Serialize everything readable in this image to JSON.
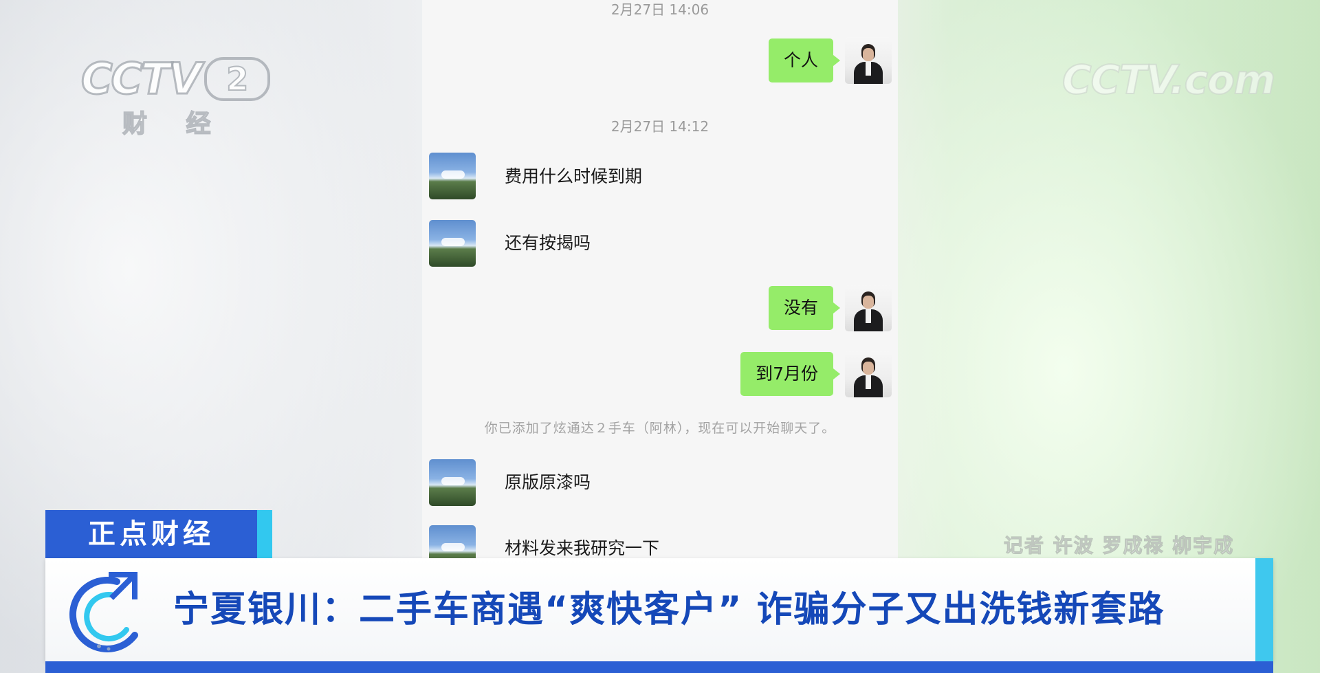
{
  "broadcast": {
    "channel_logo": "CCTV",
    "channel_number": "2",
    "channel_name": "财 经",
    "watermark": "CCTV.com",
    "program_tag": "正点财经",
    "headline": "宁夏银川：二手车商遇“爽快客户” 诈骗分子又出洗钱新套路",
    "credits": "记者 许波 罗成禄 柳宇成"
  },
  "chat": {
    "messages": [
      {
        "type": "timestamp",
        "text": "2月27日 14:06"
      },
      {
        "type": "sent",
        "text": "个人"
      },
      {
        "type": "timestamp",
        "text": "2月27日 14:12"
      },
      {
        "type": "received",
        "text": "费用什么时候到期"
      },
      {
        "type": "received",
        "text": "还有按揭吗"
      },
      {
        "type": "sent",
        "text": "没有"
      },
      {
        "type": "sent",
        "text": "到7月份"
      },
      {
        "type": "system",
        "text": "你已添加了炫通达２手车（阿林），现在可以开始聊天了。"
      },
      {
        "type": "received",
        "text": "原版原漆吗"
      },
      {
        "type": "received",
        "text": "材料发来我研究一下"
      }
    ]
  },
  "colors": {
    "sent_bubble": "#95ec69",
    "tag_blue": "#2b5fd4",
    "accent_cyan": "#32c8ef",
    "headline": "#1548b8"
  }
}
